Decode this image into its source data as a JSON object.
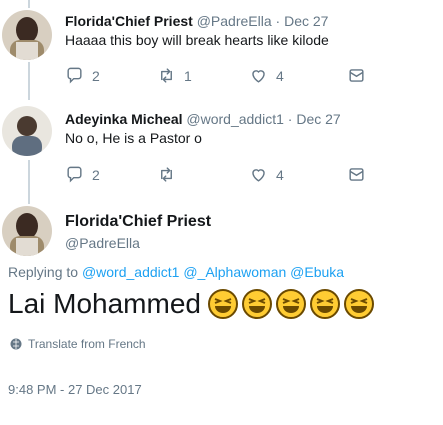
{
  "reply1": {
    "name": "Florida'Chief Priest",
    "handle": "@PadreElla",
    "separator": "·",
    "date": "Dec 27",
    "text": "Haaaa this boy will break hearts like kilode",
    "reply_count": "2",
    "retweet_count": "1",
    "like_count": "4"
  },
  "reply2": {
    "name": "Adeyinka Micheal",
    "handle": "@word_addict1",
    "separator": "·",
    "date": "Dec 27",
    "text": "No o, He is a Pastor o",
    "reply_count": "2",
    "retweet_count": "",
    "like_count": "4"
  },
  "main": {
    "name": "Florida'Chief Priest",
    "handle": "@PadreElla",
    "replying_prefix": "Replying to",
    "mentions": [
      "@word_addict1",
      "@_Alphawoman",
      "@Ebuka"
    ],
    "text": "Lai Mohammed",
    "emoji_count": 5,
    "emoji_name": "grinning-squinting-face",
    "translate_label": "Translate from French",
    "timestamp": "9:48 PM - 27 Dec 2017"
  },
  "colors": {
    "link": "#1da1f2",
    "secondary": "#657786",
    "thread_line": "#ccd6dd",
    "emoji_fill": "#ffcc33",
    "emoji_outline": "#6b4a00"
  }
}
